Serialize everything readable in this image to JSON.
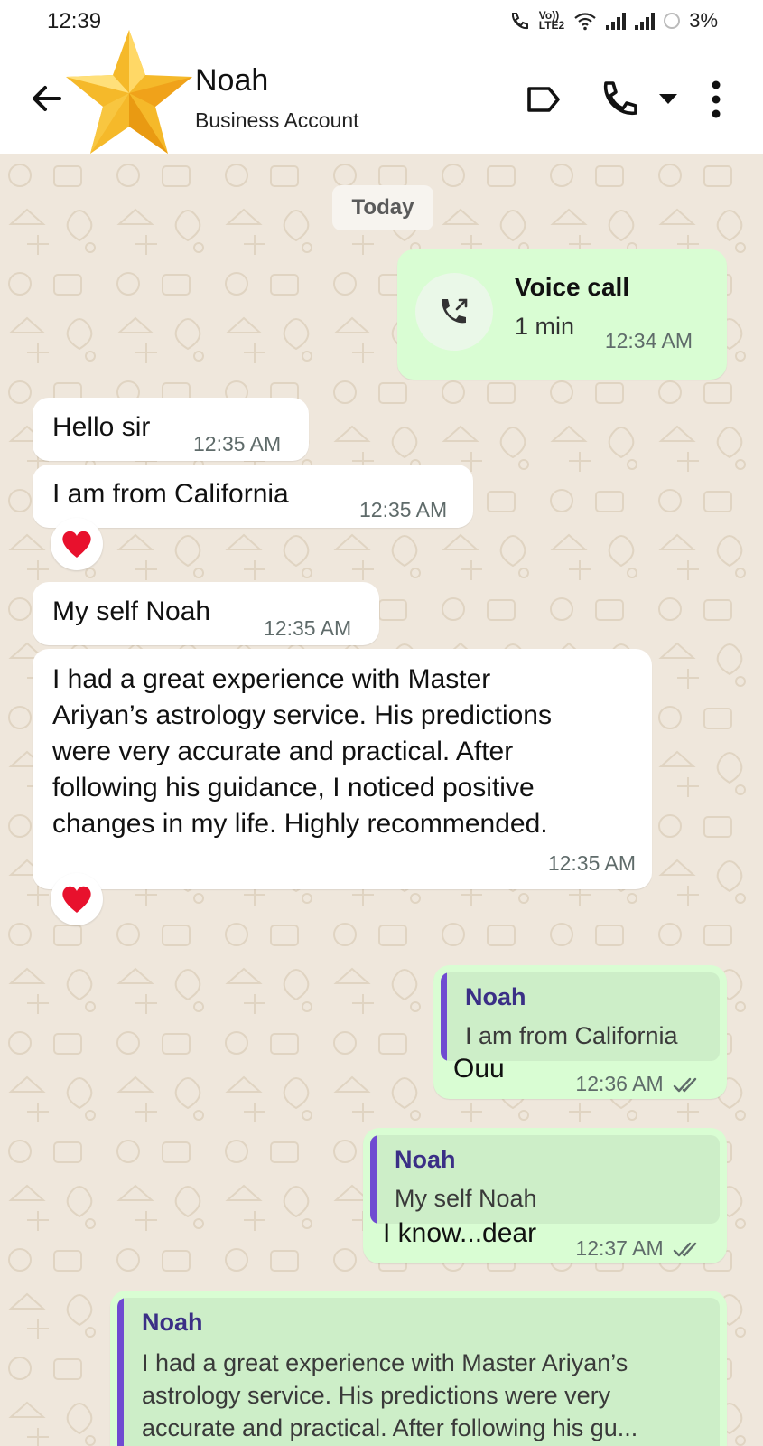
{
  "status_bar": {
    "time": "12:39",
    "volte_label_top": "Vo))",
    "volte_label_bottom": "LTE2",
    "battery": "3%"
  },
  "header": {
    "contact_name": "Noah",
    "subtitle": "Business Account",
    "icons": [
      "back-arrow-icon",
      "star-avatar",
      "label-icon",
      "phone-icon",
      "dropdown-arrow-icon",
      "more-vertical-icon"
    ]
  },
  "chat": {
    "date_chip": "Today",
    "call": {
      "title": "Voice call",
      "duration": "1 min",
      "time": "12:34 AM"
    },
    "messages": [
      {
        "text": "Hello sir",
        "time": "12:35 AM"
      },
      {
        "text": "I am from California",
        "time": "12:35 AM",
        "reaction": "❤"
      },
      {
        "text": "My self Noah",
        "time": "12:35 AM"
      },
      {
        "lines": [
          "I had a great experience with Master",
          "Ariyan’s astrology service. His predictions",
          "were very accurate and practical. After",
          "following his guidance, I noticed positive",
          "changes in my life. Highly recommended."
        ],
        "time": "12:35 AM",
        "reaction": "❤"
      }
    ],
    "replies": [
      {
        "quote_name": "Noah",
        "quote_text": "I am from California",
        "text": "Ouu",
        "time": "12:36 AM"
      },
      {
        "quote_name": "Noah",
        "quote_text": "My self Noah",
        "text": "I know...dear",
        "time": "12:37 AM"
      },
      {
        "quote_name": "Noah",
        "quote_lines": [
          "I had a great experience with Master Ariyan’s",
          "astrology service. His predictions were very",
          "accurate and practical. After following his gu..."
        ]
      }
    ]
  },
  "colors": {
    "chat_background": "#efe7dc",
    "incoming_bubble": "#ffffff",
    "outgoing_bubble": "#d9fdd3",
    "quote_bar": "#6f4bd1",
    "heart": "#e8112d"
  }
}
